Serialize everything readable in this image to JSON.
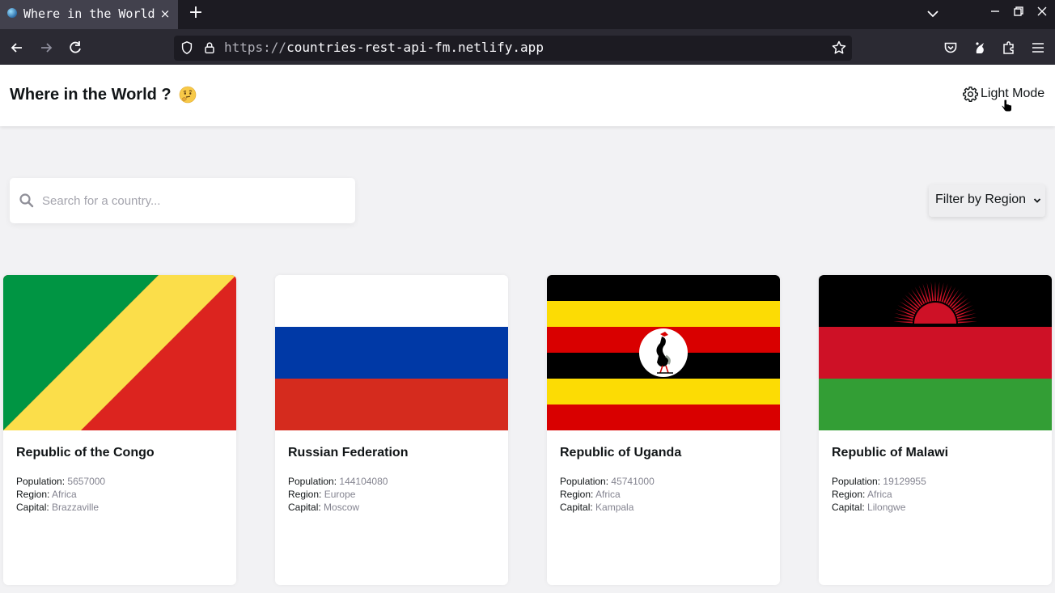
{
  "browser": {
    "tab_title": "Where in the World",
    "tab_close": "×",
    "new_tab": "+",
    "url_protocol": "https://",
    "url_host": "countries-rest-api-fm.netlify.app"
  },
  "header": {
    "title": "Where in the World ?",
    "emoji_icon": "thinking-face-emoji",
    "mode_toggle_label": "Light Mode",
    "mode_toggle_icon": "gear-icon"
  },
  "search": {
    "placeholder": "Search for a country...",
    "value": ""
  },
  "filter": {
    "label": "Filter by Region"
  },
  "countries": [
    {
      "name": "Republic of the Congo",
      "population_label": "Population:",
      "population": "5657000",
      "region_label": "Region:",
      "region": "Africa",
      "capital_label": "Capital:",
      "capital": "Brazzaville",
      "flag": "congo"
    },
    {
      "name": "Russian Federation",
      "population_label": "Population:",
      "population": "144104080",
      "region_label": "Region:",
      "region": "Europe",
      "capital_label": "Capital:",
      "capital": "Moscow",
      "flag": "russia"
    },
    {
      "name": "Republic of Uganda",
      "population_label": "Population:",
      "population": "45741000",
      "region_label": "Region:",
      "region": "Africa",
      "capital_label": "Capital:",
      "capital": "Kampala",
      "flag": "uganda"
    },
    {
      "name": "Republic of Malawi",
      "population_label": "Population:",
      "population": "19129955",
      "region_label": "Region:",
      "region": "Africa",
      "capital_label": "Capital:",
      "capital": "Lilongwe",
      "flag": "malawi"
    }
  ],
  "colors": {
    "page_background": "#f2f2f4",
    "card_background": "#ffffff",
    "text": "#111517",
    "secondary_text": "#848490"
  }
}
